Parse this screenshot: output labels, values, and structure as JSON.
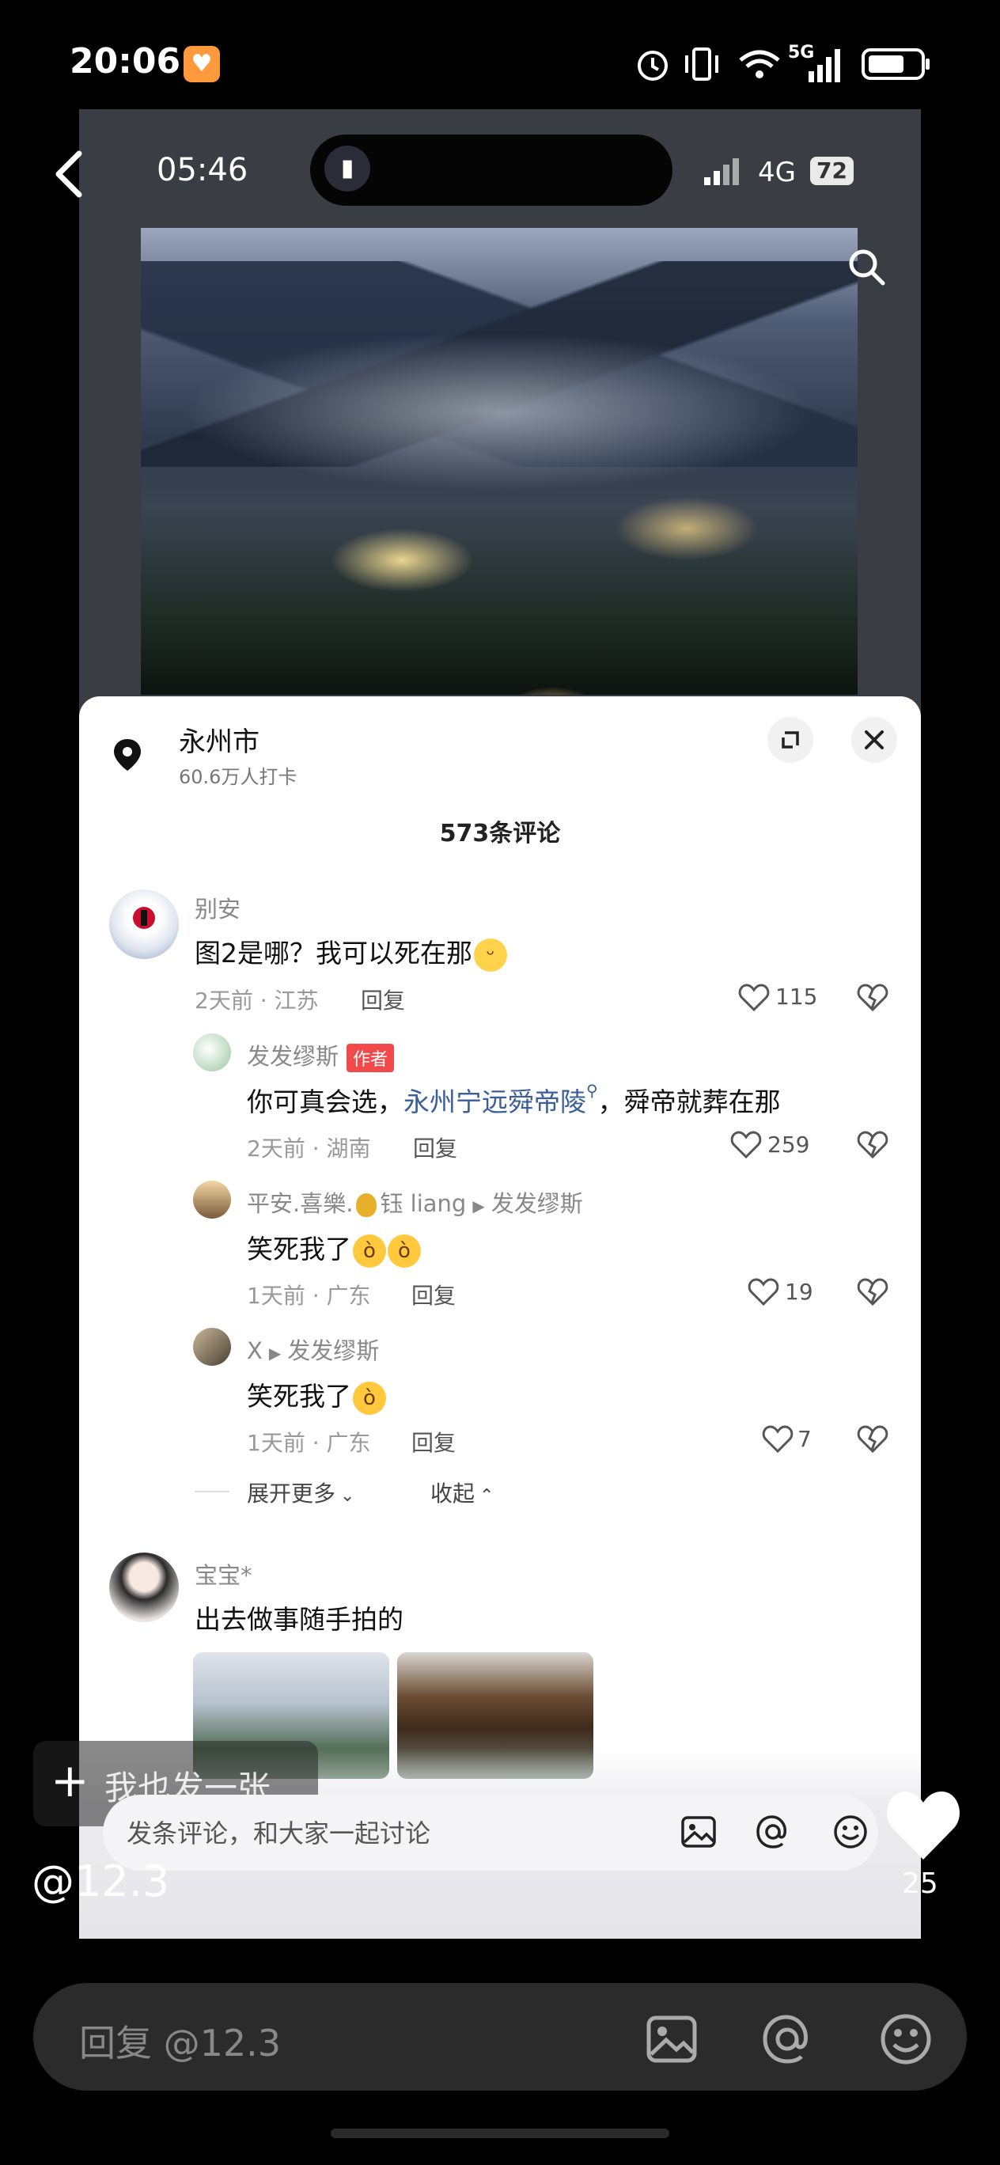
{
  "status_bar": {
    "time": "20:06",
    "network": "5G"
  },
  "inner_status": {
    "time": "05:46",
    "network": "4G",
    "battery": "72"
  },
  "location": {
    "name": "永州市",
    "checkins": "60.6万人打卡"
  },
  "comments_count": "573条评论",
  "comments": [
    {
      "user": "别安",
      "text": "图2是哪？我可以死在那",
      "meta": "2天前 · 江苏",
      "reply_label": "回复",
      "likes": "115"
    }
  ],
  "replies": [
    {
      "user": "发发缪斯",
      "badge": "作者",
      "text_before": "你可真会选，",
      "link": "永州宁远舜帝陵",
      "text_after": "，舜帝就葬在那",
      "meta": "2天前 · 湖南",
      "reply_label": "回复",
      "likes": "259"
    },
    {
      "user": "平安.喜樂.",
      "user_tail": "钰 liang",
      "target": "发发缪斯",
      "text": "笑死我了",
      "meta": "1天前 · 广东",
      "reply_label": "回复",
      "likes": "19"
    },
    {
      "user": "X",
      "target": "发发缪斯",
      "text": "笑死我了",
      "meta": "1天前 · 广东",
      "reply_label": "回复",
      "likes": "7"
    }
  ],
  "expand_more": "展开更多",
  "collapse": "收起",
  "comment2": {
    "user": "宝宝*",
    "text": "出去做事随手拍的"
  },
  "post_button": "我也发一张",
  "comment_input_placeholder": "发条评论，和大家一起讨论",
  "like_count": "25",
  "handle": "@12.3",
  "reply_placeholder": "回复 @12.3",
  "colors": {
    "link": "#3a5e9c",
    "author_badge": "#f24a4a"
  }
}
